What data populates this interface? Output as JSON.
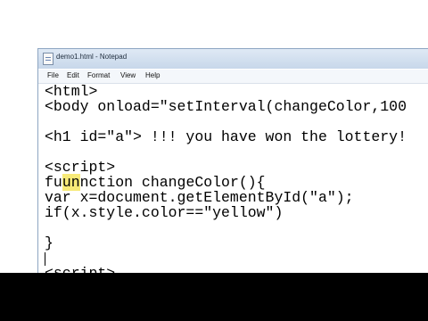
{
  "window": {
    "title": "demo1.html - Notepad"
  },
  "menu": [
    {
      "label": "File"
    },
    {
      "label": "Edit"
    },
    {
      "label": "Format"
    },
    {
      "label": "View"
    },
    {
      "label": "Help"
    }
  ],
  "editor": {
    "lines": [
      "<html>",
      "<body onload=\"setInterval(changeColor,100",
      "",
      "<h1 id=\"a\"> !!! you have won the lottery!",
      "",
      "<script>",
      "fu",
      "nction changeColor(){",
      "var x=document.getElementById(\"a\");",
      "if(x.style.color==\"yellow\")",
      "",
      "}",
      "",
      "<script>"
    ],
    "highlight": "un"
  }
}
